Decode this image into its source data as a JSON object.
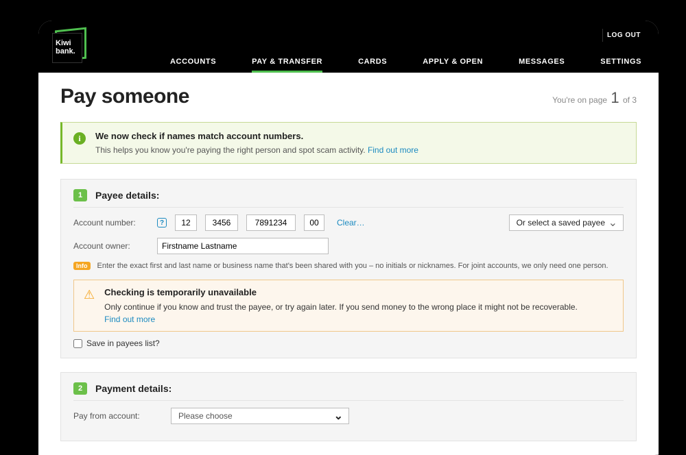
{
  "logo": {
    "line1": "Kiwi",
    "line2": "bank."
  },
  "logout": "LOG OUT",
  "nav": {
    "items": [
      {
        "label": "ACCOUNTS",
        "active": false
      },
      {
        "label": "PAY & TRANSFER",
        "active": true
      },
      {
        "label": "CARDS",
        "active": false
      },
      {
        "label": "APPLY & OPEN",
        "active": false
      },
      {
        "label": "MESSAGES",
        "active": false
      },
      {
        "label": "SETTINGS",
        "active": false
      }
    ]
  },
  "title": "Pay someone",
  "progress": {
    "prefix": "You're on page ",
    "current": "1",
    "suffix": " of 3"
  },
  "banner_match": {
    "title": "We now check if names match account numbers.",
    "body": "This helps you know you're paying the right person and spot scam activity. ",
    "link": "Find out more"
  },
  "payee": {
    "step": "1",
    "heading": "Payee details:",
    "account_number_label": "Account number:",
    "bank": "12",
    "branch": "3456",
    "account": "7891234",
    "suffix": "00",
    "clear": "Clear…",
    "saved_payee": "Or select a saved payee",
    "owner_label": "Account owner:",
    "owner_value": "Firstname Lastname",
    "info_badge": "Info",
    "info_text": "Enter the exact first and last name or business name that's been shared with you – no initials or nicknames. For joint accounts, we only need one person.",
    "warn_title": "Checking is temporarily unavailable",
    "warn_body": "Only continue if you know and trust the payee, or try again later. If you send money to the wrong place it might not be recoverable.",
    "warn_link": "Find out more",
    "save_label": "Save in payees list?"
  },
  "payment": {
    "step": "2",
    "heading": "Payment details:",
    "pay_from_label": "Pay from account:",
    "pay_from_value": "Please choose"
  }
}
